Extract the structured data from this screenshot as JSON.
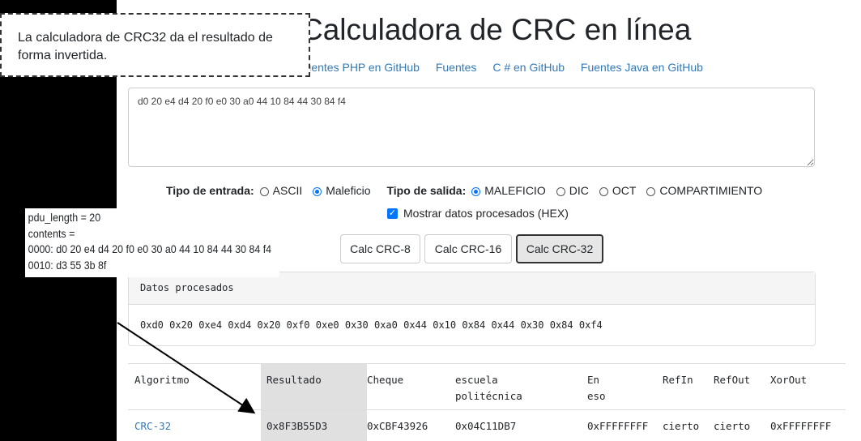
{
  "page": {
    "title": "Calculadora de CRC en línea",
    "links": [
      "Fuentes PHP en GitHub",
      "Fuentes",
      "C # en GitHub",
      "Fuentes Java en GitHub"
    ],
    "input_text": "d0 20 e4 d4 20 f0 e0 30 a0 44 10 84 44 30 84 f4",
    "input_type": {
      "label": "Tipo de entrada:",
      "options": [
        "ASCII",
        "Maleficio"
      ],
      "selected": "Maleficio"
    },
    "output_type": {
      "label": "Tipo de salida:",
      "options": [
        "MALEFICIO",
        "DIC",
        "OCT",
        "COMPARTIMIENTO"
      ],
      "selected": "MALEFICIO"
    },
    "show_processed": {
      "label": "Mostrar datos procesados (HEX)",
      "checked": true
    },
    "buttons": [
      "Calc CRC-8",
      "Calc CRC-16",
      "Calc CRC-32"
    ],
    "active_button": "Calc CRC-32",
    "processed": {
      "header": "Datos procesados",
      "body": "0xd0 0x20 0xe4 0xd4 0x20 0xf0 0xe0 0x30 0xa0 0x44 0x10 0x84 0x44 0x30 0x84 0xf4"
    },
    "table": {
      "headers": [
        "Algoritmo",
        "Resultado",
        "Cheque",
        "escuela\npolitécnica",
        "En\neso",
        "RefIn",
        "RefOut",
        "XorOut"
      ],
      "rows": [
        [
          "CRC-32",
          "0x8F3B55D3",
          "0xCBF43926",
          "0x04C11DB7",
          "0xFFFFFFFF",
          "cierto",
          "cierto",
          "0xFFFFFFFF"
        ]
      ]
    }
  },
  "callout": {
    "text": "La calculadora de CRC32 da el resultado de forma invertida."
  },
  "snippet": {
    "lines": [
      "pdu_length = 20",
      "contents =",
      "0000: d0 20 e4 d4 20 f0 e0 30 a0 44 10 84 44 30 84 f4",
      "0010: d3 55 3b 8f"
    ]
  },
  "colors": {
    "link": "#337ab7",
    "accent": "#0075ff"
  }
}
